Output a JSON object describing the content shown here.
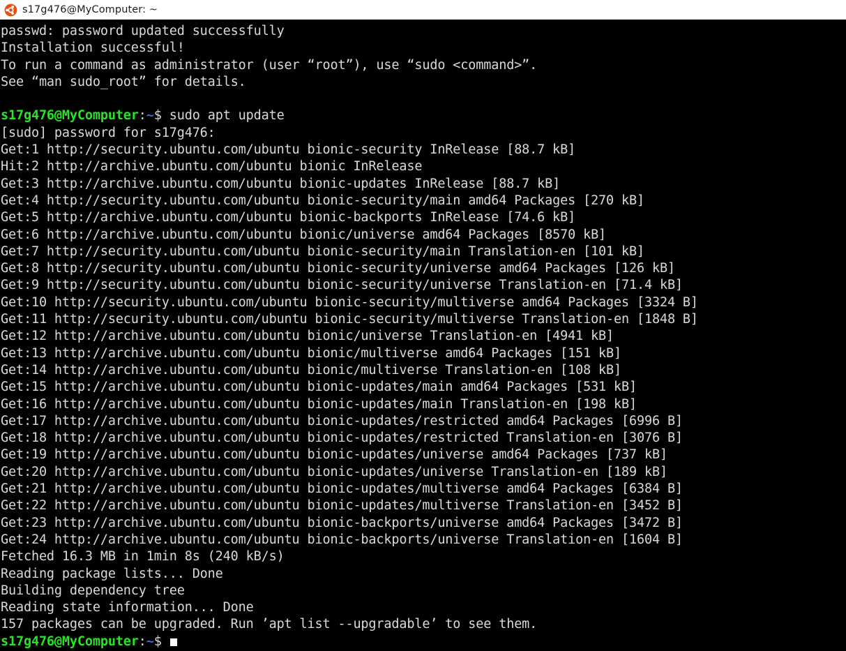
{
  "window": {
    "title": "s17g476@MyComputer: ~",
    "icon": "ubuntu-logo-icon",
    "titlebar_bg": "#ffffff",
    "terminal_bg": "#000000",
    "text_color": "#d9d9d9",
    "prompt_user_color": "#25e525",
    "prompt_path_color": "#3a6ec9"
  },
  "terminal": {
    "user": "s17g476",
    "host": "MyComputer",
    "path": "~",
    "prompt_symbol": "$",
    "lines": [
      {
        "type": "plain",
        "text": "passwd: password updated successfully"
      },
      {
        "type": "plain",
        "text": "Installation successful!"
      },
      {
        "type": "plain",
        "text": "To run a command as administrator (user “root”), use “sudo <command>”."
      },
      {
        "type": "plain",
        "text": "See “man sudo_root” for details."
      },
      {
        "type": "blank",
        "text": ""
      },
      {
        "type": "prompt",
        "command": "sudo apt update"
      },
      {
        "type": "plain",
        "text": "[sudo] password for s17g476:"
      },
      {
        "type": "plain",
        "text": "Get:1 http://security.ubuntu.com/ubuntu bionic-security InRelease [88.7 kB]"
      },
      {
        "type": "plain",
        "text": "Hit:2 http://archive.ubuntu.com/ubuntu bionic InRelease"
      },
      {
        "type": "plain",
        "text": "Get:3 http://archive.ubuntu.com/ubuntu bionic-updates InRelease [88.7 kB]"
      },
      {
        "type": "plain",
        "text": "Get:4 http://security.ubuntu.com/ubuntu bionic-security/main amd64 Packages [270 kB]"
      },
      {
        "type": "plain",
        "text": "Get:5 http://archive.ubuntu.com/ubuntu bionic-backports InRelease [74.6 kB]"
      },
      {
        "type": "plain",
        "text": "Get:6 http://archive.ubuntu.com/ubuntu bionic/universe amd64 Packages [8570 kB]"
      },
      {
        "type": "plain",
        "text": "Get:7 http://security.ubuntu.com/ubuntu bionic-security/main Translation-en [101 kB]"
      },
      {
        "type": "plain",
        "text": "Get:8 http://security.ubuntu.com/ubuntu bionic-security/universe amd64 Packages [126 kB]"
      },
      {
        "type": "plain",
        "text": "Get:9 http://security.ubuntu.com/ubuntu bionic-security/universe Translation-en [71.4 kB]"
      },
      {
        "type": "plain",
        "text": "Get:10 http://security.ubuntu.com/ubuntu bionic-security/multiverse amd64 Packages [3324 B]"
      },
      {
        "type": "plain",
        "text": "Get:11 http://security.ubuntu.com/ubuntu bionic-security/multiverse Translation-en [1848 B]"
      },
      {
        "type": "plain",
        "text": "Get:12 http://archive.ubuntu.com/ubuntu bionic/universe Translation-en [4941 kB]"
      },
      {
        "type": "plain",
        "text": "Get:13 http://archive.ubuntu.com/ubuntu bionic/multiverse amd64 Packages [151 kB]"
      },
      {
        "type": "plain",
        "text": "Get:14 http://archive.ubuntu.com/ubuntu bionic/multiverse Translation-en [108 kB]"
      },
      {
        "type": "plain",
        "text": "Get:15 http://archive.ubuntu.com/ubuntu bionic-updates/main amd64 Packages [531 kB]"
      },
      {
        "type": "plain",
        "text": "Get:16 http://archive.ubuntu.com/ubuntu bionic-updates/main Translation-en [198 kB]"
      },
      {
        "type": "plain",
        "text": "Get:17 http://archive.ubuntu.com/ubuntu bionic-updates/restricted amd64 Packages [6996 B]"
      },
      {
        "type": "plain",
        "text": "Get:18 http://archive.ubuntu.com/ubuntu bionic-updates/restricted Translation-en [3076 B]"
      },
      {
        "type": "plain",
        "text": "Get:19 http://archive.ubuntu.com/ubuntu bionic-updates/universe amd64 Packages [737 kB]"
      },
      {
        "type": "plain",
        "text": "Get:20 http://archive.ubuntu.com/ubuntu bionic-updates/universe Translation-en [189 kB]"
      },
      {
        "type": "plain",
        "text": "Get:21 http://archive.ubuntu.com/ubuntu bionic-updates/multiverse amd64 Packages [6384 B]"
      },
      {
        "type": "plain",
        "text": "Get:22 http://archive.ubuntu.com/ubuntu bionic-updates/multiverse Translation-en [3452 B]"
      },
      {
        "type": "plain",
        "text": "Get:23 http://archive.ubuntu.com/ubuntu bionic-backports/universe amd64 Packages [3472 B]"
      },
      {
        "type": "plain",
        "text": "Get:24 http://archive.ubuntu.com/ubuntu bionic-backports/universe Translation-en [1604 B]"
      },
      {
        "type": "plain",
        "text": "Fetched 16.3 MB in 1min 8s (240 kB/s)"
      },
      {
        "type": "plain",
        "text": "Reading package lists... Done"
      },
      {
        "type": "plain",
        "text": "Building dependency tree"
      },
      {
        "type": "plain",
        "text": "Reading state information... Done"
      },
      {
        "type": "plain",
        "text": "157 packages can be upgraded. Run ’apt list --upgradable’ to see them."
      },
      {
        "type": "prompt_cursor",
        "command": ""
      }
    ]
  }
}
